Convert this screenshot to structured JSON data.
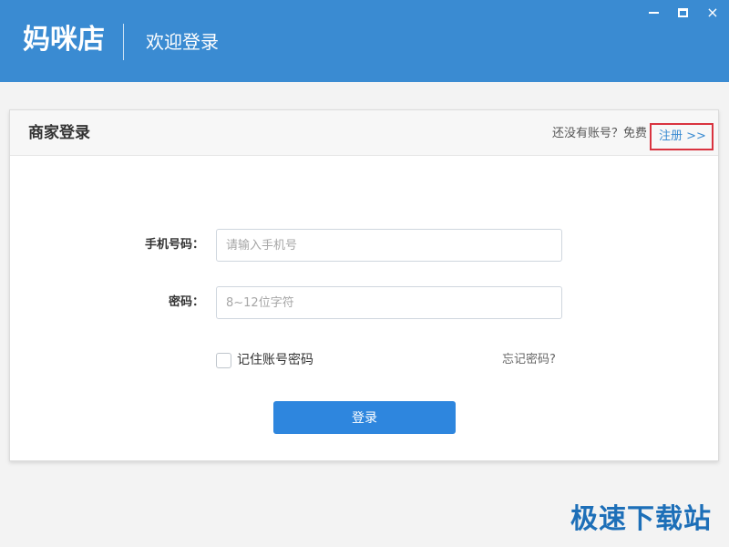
{
  "window": {
    "brand": "妈咪店",
    "welcome": "欢迎登录",
    "controls": {
      "minimize": "minimize",
      "maximize": "maximize",
      "close": "×"
    }
  },
  "login_card": {
    "title": "商家登录",
    "signup_hint": "还没有账号？免费",
    "signup_link": "注册 >>",
    "phone": {
      "label": "手机号码：",
      "placeholder": "请输入手机号",
      "value": ""
    },
    "password": {
      "label": "密码：",
      "placeholder": "8~12位字符",
      "value": ""
    },
    "remember_label": "记住账号密码",
    "remember_checked": false,
    "forgot_label": "忘记密码?",
    "login_button": "登录"
  },
  "watermark": "极速下载站",
  "colors": {
    "header": "#3a8bd2",
    "primary_button": "#2e86de",
    "link": "#3a8bd2",
    "highlight_box": "#d9333f",
    "watermark": "#1d6fb8"
  }
}
